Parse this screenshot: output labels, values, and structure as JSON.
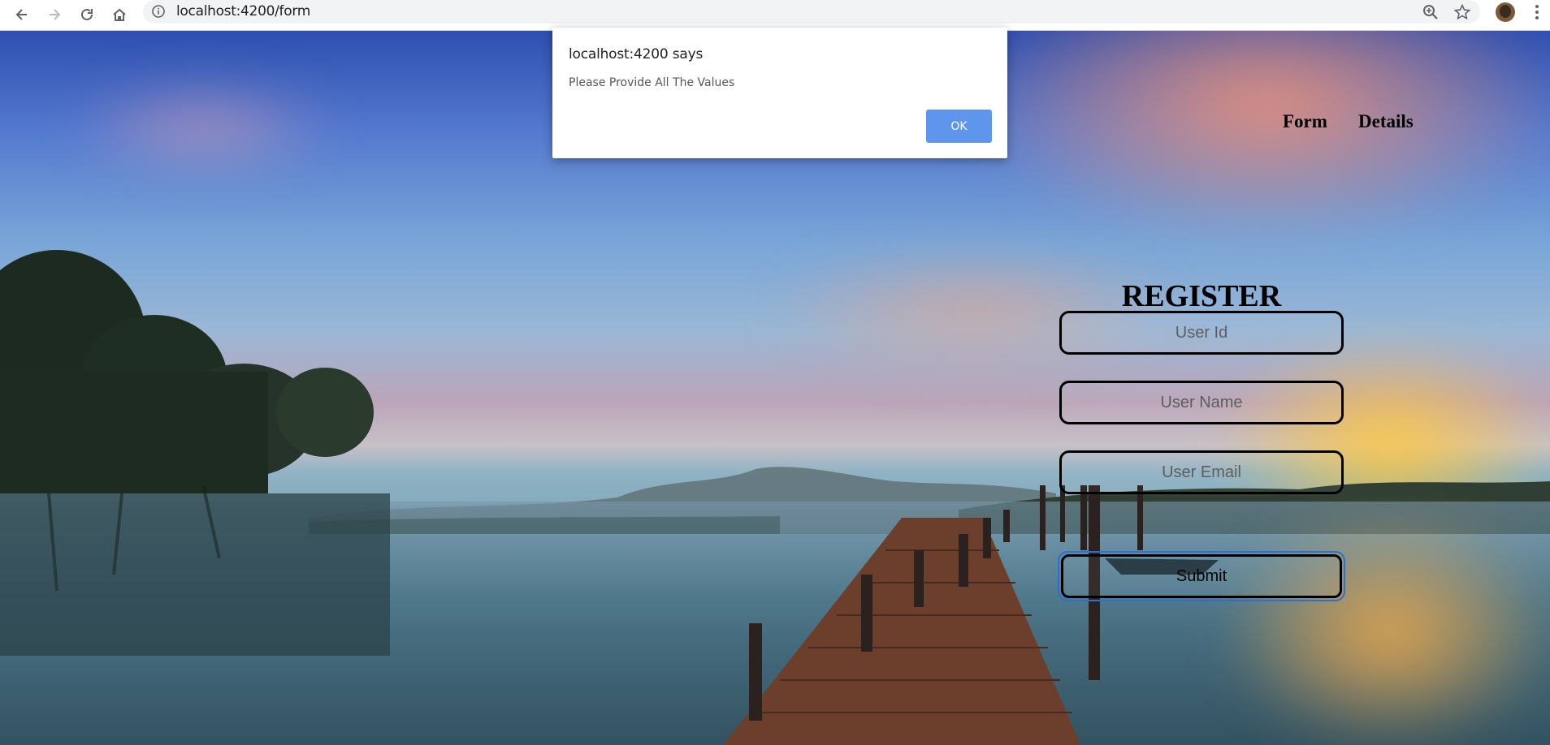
{
  "browser": {
    "url": "localhost:4200/form"
  },
  "nav": {
    "form": "Form",
    "details": "Details"
  },
  "register": {
    "title": "REGISTER",
    "user_id_placeholder": "User Id",
    "user_name_placeholder": "User Name",
    "user_email_placeholder": "User Email",
    "submit_label": "Submit"
  },
  "alert": {
    "title": "localhost:4200 says",
    "message": "Please Provide All The Values",
    "ok_label": "OK"
  },
  "colors": {
    "ok_button": "#5f95ec",
    "submit_focus_ring": "#2c6fd6"
  }
}
